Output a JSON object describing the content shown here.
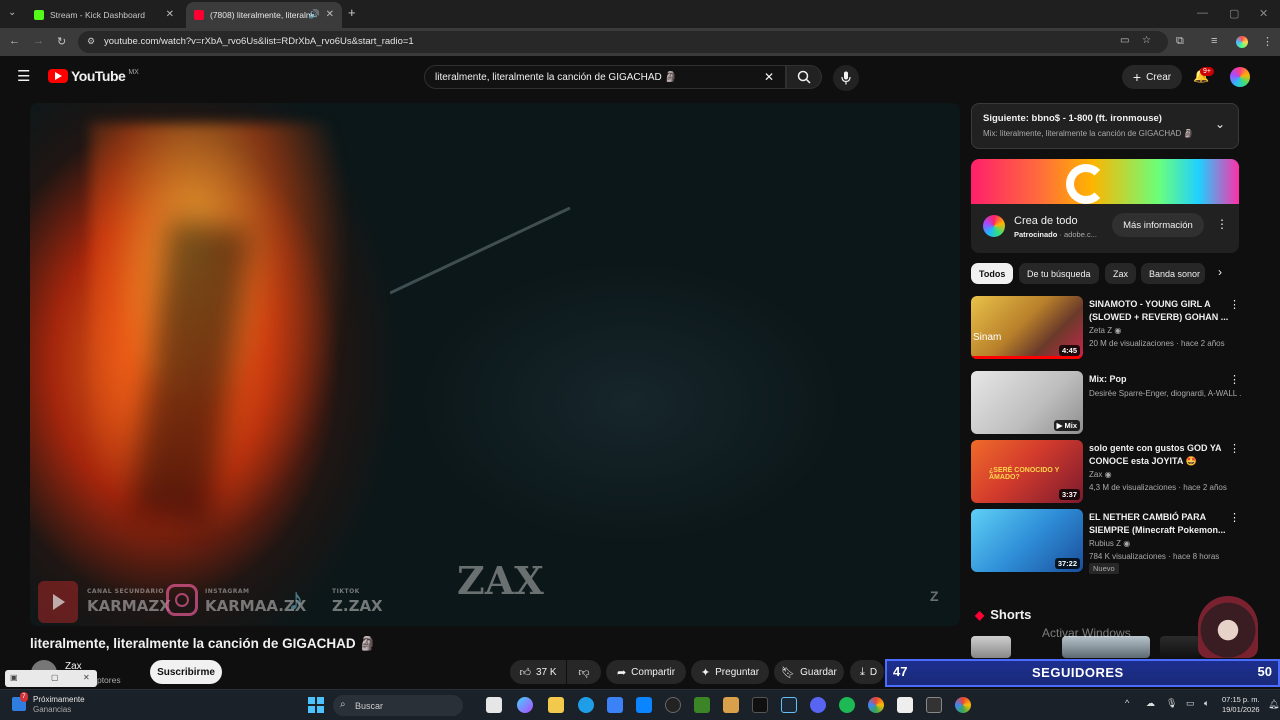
{
  "browser": {
    "tabs": [
      {
        "title": "Stream - Kick Dashboard",
        "favicon_color": "#53fc18"
      },
      {
        "title": "(7808) literalmente, literalm",
        "favicon_color": "#ff0033"
      }
    ],
    "url": "youtube.com/watch?v=rXbA_rvo6Us&list=RDrXbA_rvo6Us&start_radio=1"
  },
  "youtube": {
    "logo": "YouTube",
    "region": "MX",
    "search_query": "literalmente, literalmente la canción de GIGACHAD 🗿",
    "create_label": "Crear",
    "notif_count": "9+"
  },
  "video": {
    "overlay": {
      "canal_secundario_label": "CANAL SECUNDARIO",
      "canal_secundario": "KARMAZX",
      "instagram_label": "INSTAGRAM",
      "instagram": "KARMAA.ZX",
      "tiktok_label": "TIKTOK",
      "tiktok": "Z.ZAX",
      "watermark": "ZAX"
    },
    "title": "literalmente, literalmente la canción de GIGACHAD 🗿",
    "channel": "Zax",
    "subscribers": "criptores",
    "subscribe_label": "Suscribirme",
    "likes": "37 K",
    "share_label": "Compartir",
    "ask_label": "Preguntar",
    "save_label": "Guardar",
    "download_label": "D"
  },
  "sidebar": {
    "next": {
      "label": "Siguiente: bbno$ - 1-800 (ft. ironmouse)",
      "mix": "Mix: literalmente, literalmente la canción de GIGACHAD 🗿"
    },
    "ad": {
      "title": "Crea de todo",
      "sponsored": "Patrocinado",
      "domain": "adobe.c...",
      "cta": "Más información"
    },
    "chips": [
      "Todos",
      "De tu búsqueda",
      "Zax",
      "Banda sonor"
    ],
    "recommendations": [
      {
        "title": "SINAMOTO - YOUNG GIRL A (SLOWED + REVERB) GOHAN ...",
        "channel": "Zeta Z",
        "meta": "20 M de visualizaciones · hace 2 años",
        "duration": "4:45",
        "thumb_color": "#c9a23a"
      },
      {
        "title": "Mix: Pop",
        "channel": "Desirée Sparre-Enger, diognardi, A-WALL ...",
        "meta": "",
        "duration": "Mix",
        "thumb_color": "#cfcfcf"
      },
      {
        "title": "solo gente con gustos GOD YA CONOCE esta JOYITA 🤩",
        "channel": "Zax",
        "meta": "4,3 M de visualizaciones · hace 2 años",
        "duration": "3:37",
        "thumb_color": "#d23b2c"
      },
      {
        "title": "EL NETHER CAMBIÓ PARA SIEMPRE (Minecraft Pokemon...",
        "channel": "Rubius Z",
        "meta": "784 K visualizaciones · hace 8 horas",
        "duration": "37:22",
        "thumb_color": "#3a9ad9",
        "badge": "Nuevo"
      }
    ],
    "shorts_label": "Shorts"
  },
  "windows_notice": "Activar Windows",
  "stream_overlay": {
    "left_count": "47",
    "label": "SEGUIDORES",
    "right_count": "50"
  },
  "taskbar": {
    "widget_title": "Próximamente",
    "widget_sub": "Ganancias",
    "widget_badge": "7",
    "search_placeholder": "Buscar",
    "time": "07:15 p. m.",
    "date": "19/01/2026"
  }
}
